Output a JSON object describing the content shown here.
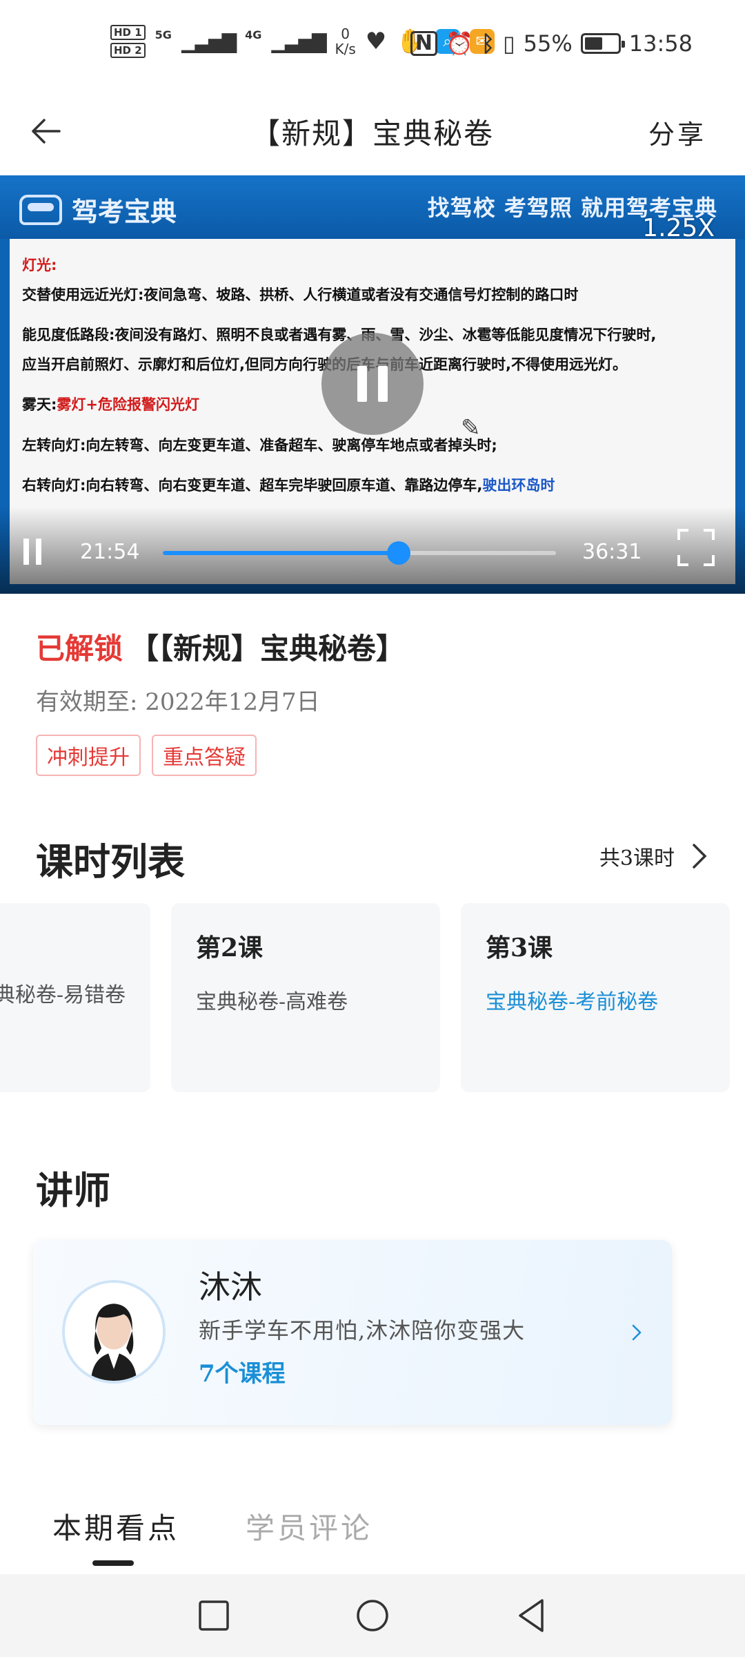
{
  "status_bar": {
    "sim1": "HD 1",
    "sim2": "HD 2",
    "signal1_tag": "5G",
    "signal2_tag": "4G",
    "net_speed_value": "0",
    "net_speed_unit": "K/s",
    "battery_percent": "55%",
    "battery_level": 0.55,
    "time": "13:58",
    "icons": [
      "heart-rate-icon",
      "hand-icon",
      "search-app-icon",
      "mail-app-icon",
      "nfc-icon",
      "alarm-icon",
      "bluetooth-icon",
      "vibrate-icon"
    ]
  },
  "topbar": {
    "title": "【新规】宝典秘卷",
    "share_label": "分享"
  },
  "video": {
    "logo_text": "驾考宝典",
    "slogan": "找驾校 考驾照 就用驾考宝典",
    "speed_label": "1.25X",
    "slide": {
      "heading": "灯光:",
      "line1_label": "交替使用远近光灯:",
      "line1_text": "夜间急弯、坡路、拱桥、人行横道或者没有交通信号灯控制的路口时",
      "line2": "能见度低路段:夜间没有路灯、照明不良或者遇有雾、雨、雪、沙尘、冰雹等低能见度情况下行驶时,",
      "line3": "应当开启前照灯、示廓灯和后位灯,但同方向行驶的后车与前车近距离行驶时,不得使用远光灯。",
      "fog_label": "雾天:",
      "fog_text": "雾灯+危险报警闪光灯",
      "left_turn": "左转向灯:向左转弯、向左变更车道、准备超车、驶离停车地点或者掉头时;",
      "right_turn": "右转向灯:向右转弯、向右变更车道、超车完毕驶回原车道、靠路边停车,",
      "right_turn_tail": "驶出环岛时"
    },
    "current_time": "21:54",
    "total_time": "36:31",
    "progress": 0.6
  },
  "info": {
    "unlock_label": "已解锁",
    "course_title": "【【新规】宝典秘卷】",
    "validity": "有效期至: 2022年12月7日",
    "tags": [
      "冲刺提升",
      "重点答疑"
    ]
  },
  "lessons": {
    "section_title": "课时列表",
    "count_label": "共3课时",
    "items": [
      {
        "num": "",
        "name": "宝典秘卷-易错卷"
      },
      {
        "num": "第2课",
        "name": "宝典秘卷-高难卷"
      },
      {
        "num": "第3课",
        "name": "宝典秘卷-考前秘卷"
      }
    ]
  },
  "teacher": {
    "section_title": "讲师",
    "name": "沐沐",
    "desc": "新手学车不用怕,沐沐陪你变强大",
    "courses": "7个课程"
  },
  "tabs": [
    {
      "label": "本期看点",
      "active": true
    },
    {
      "label": "学员评论",
      "active": false
    }
  ]
}
